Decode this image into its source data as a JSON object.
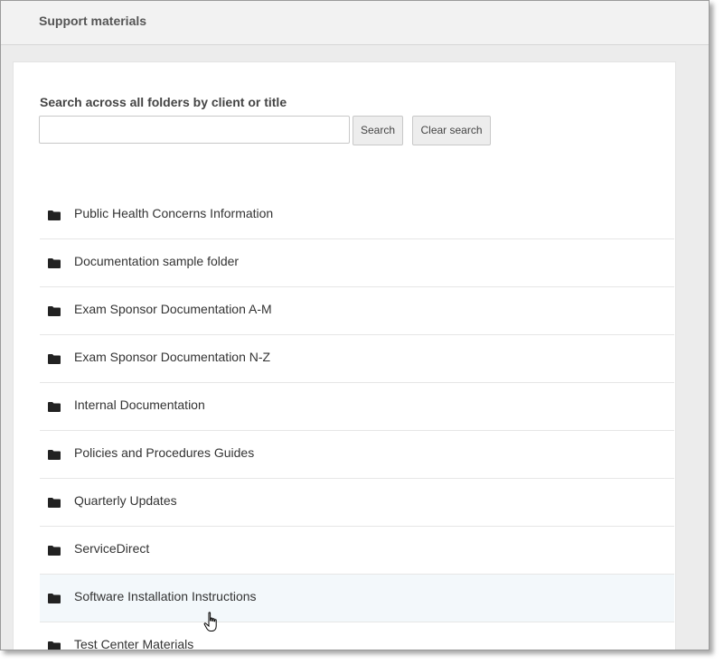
{
  "header": {
    "title": "Support materials"
  },
  "search": {
    "label": "Search across all folders by client or title",
    "value": "",
    "placeholder": "",
    "search_button": "Search",
    "clear_button": "Clear search"
  },
  "folders": [
    {
      "label": "Public Health Concerns Information",
      "icon": "folder-icon"
    },
    {
      "label": "Documentation sample folder",
      "icon": "folder-icon"
    },
    {
      "label": "Exam Sponsor Documentation A-M",
      "icon": "folder-icon"
    },
    {
      "label": "Exam Sponsor Documentation N-Z",
      "icon": "folder-icon"
    },
    {
      "label": "Internal Documentation",
      "icon": "folder-icon"
    },
    {
      "label": "Policies and Procedures Guides",
      "icon": "folder-icon"
    },
    {
      "label": "Quarterly Updates",
      "icon": "folder-icon"
    },
    {
      "label": "ServiceDirect",
      "icon": "folder-icon"
    },
    {
      "label": "Software Installation Instructions",
      "icon": "folder-icon",
      "hovered": true
    },
    {
      "label": "Test Center Materials",
      "icon": "folder-icon"
    }
  ],
  "colors": {
    "header_bg": "#f2f2f2",
    "panel_bg": "#ffffff",
    "hover_row_bg": "#f3f8fb",
    "text": "#333333"
  }
}
